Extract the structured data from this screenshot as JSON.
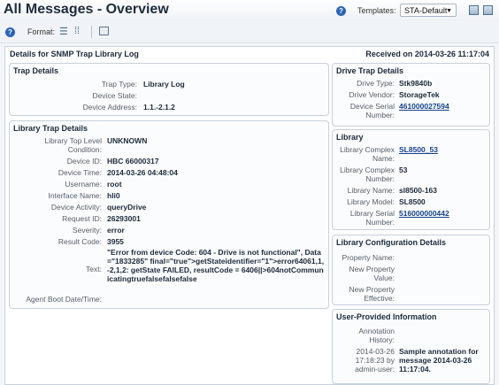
{
  "header": {
    "title": "All Messages - Overview",
    "templates_label": "Templates:",
    "template_value": "STA-Default"
  },
  "toolbar": {
    "format_label": "Format:"
  },
  "main": {
    "title": "Details for SNMP Trap Library Log",
    "received": "Received on 2014-03-26 11:17:04"
  },
  "trap_details": {
    "title": "Trap Details",
    "trap_type_label": "Trap Type:",
    "trap_type": "Library Log",
    "device_state_label": "Device State:",
    "device_state": "",
    "device_address_label": "Device Address:",
    "device_address": "1.1.-2.1.2"
  },
  "library_trap": {
    "title": "Library Trap Details",
    "top_level_label": "Library Top Level Condition:",
    "top_level": "UNKNOWN",
    "device_id_label": "Device ID:",
    "device_id": "HBC 66000317",
    "device_time_label": "Device Time:",
    "device_time": "2014-03-26 04:48:04",
    "username_label": "Username:",
    "username": "root",
    "interface_label": "Interface Name:",
    "interface": "hli0",
    "activity_label": "Device Activity:",
    "activity": "queryDrive",
    "request_label": "Request ID:",
    "request": "26293001",
    "severity_label": "Severity:",
    "severity": "error",
    "result_label": "Result Code:",
    "result": "3955",
    "text_label": "Text:",
    "text": "\"Error from device Code: 604 - Drive is not functional\", Data=\"1833285\" final=\"true\">getStateidentifier=\"1\">error64061,1,-2,1,2: getState FAILED, resultCode = 6406||>604notCommunicatingtruefalsefalsefalse",
    "boot_label": "Agent Boot Date/Time:",
    "boot": ""
  },
  "drive_trap": {
    "title": "Drive Trap Details",
    "type_label": "Drive Type:",
    "type": "Stk9840b",
    "vendor_label": "Drive Vendor:",
    "vendor": "StorageTek",
    "serial_label": "Device Serial Number:",
    "serial": "461000027594"
  },
  "library": {
    "title": "Library",
    "complex_name_label": "Library Complex Name:",
    "complex_name": "SL8500_53",
    "complex_label": "Library Complex Number:",
    "complex": "53",
    "name_label": "Library Name:",
    "name": "sl8500-163",
    "model_label": "Library Model:",
    "model": "SL8500",
    "serial_label": "Library Serial Number:",
    "serial": "516000000442"
  },
  "config": {
    "title": "Library Configuration Details",
    "prop_name_label": "Property Name:",
    "prop_value_label": "New Property Value:",
    "prop_eff_label": "New Property Effective:"
  },
  "user_info": {
    "title": "User-Provided Information",
    "history_label": "Annotation History:",
    "entry_meta": "2014-03-26 17:18:23 by admin-user:",
    "entry_text": "Sample annotation for message 2014-03-26 11:17:04."
  }
}
